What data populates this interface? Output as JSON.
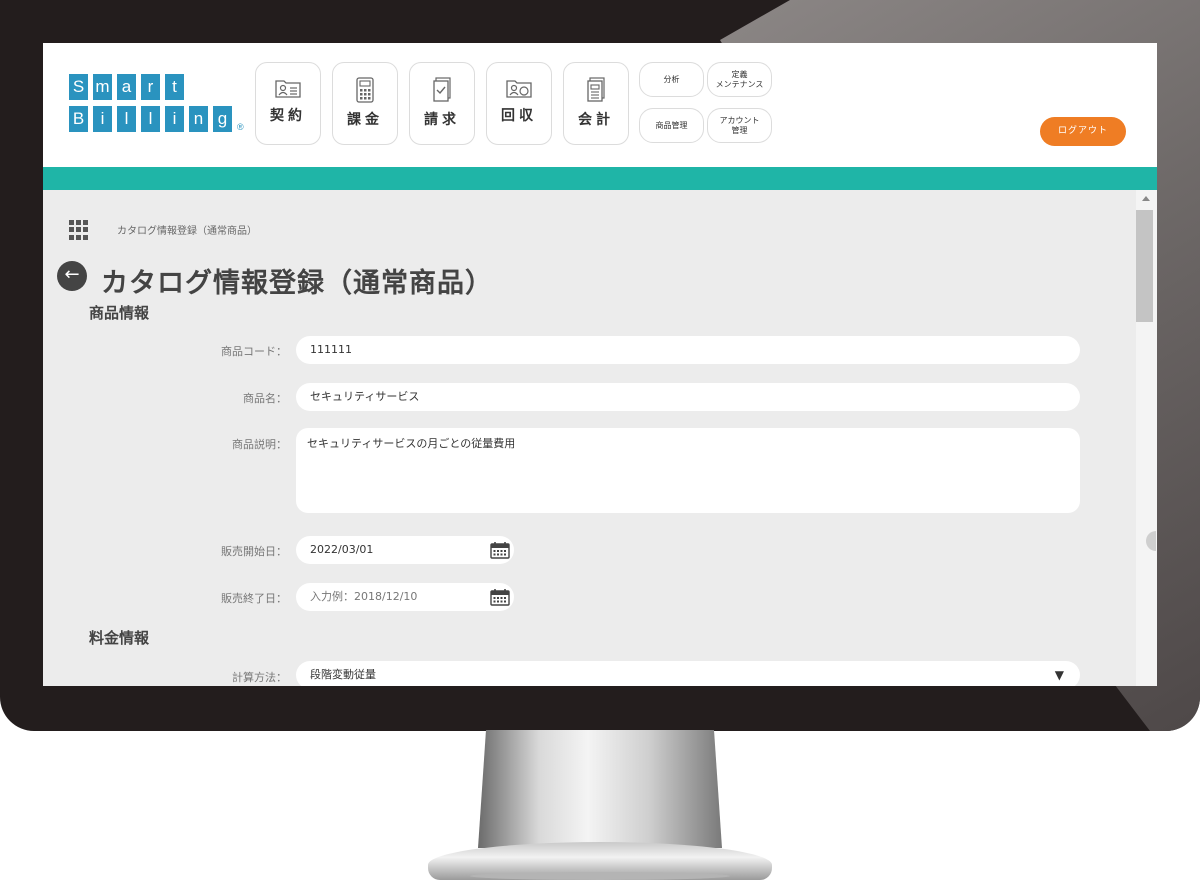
{
  "logo": {
    "row1": [
      "S",
      "m",
      "a",
      "r",
      "t"
    ],
    "row2": [
      "B",
      "i",
      "l",
      "l",
      "i",
      "n",
      "g"
    ],
    "reg": "®"
  },
  "nav": {
    "main": [
      {
        "label": "契約",
        "icon": "contract-icon"
      },
      {
        "label": "課金",
        "icon": "calculator-icon"
      },
      {
        "label": "請求",
        "icon": "invoice-icon"
      },
      {
        "label": "回収",
        "icon": "collection-icon"
      },
      {
        "label": "会計",
        "icon": "accounting-icon"
      }
    ],
    "sub": {
      "analysis": "分析",
      "definition_maintenance": "定義\nメンテナンス",
      "product_management": "商品管理",
      "account_management": "アカウント\n管理"
    },
    "logout": "ログアウト"
  },
  "breadcrumb": "カタログ情報登録（通常商品）",
  "page_title": "カタログ情報登録（通常商品）",
  "sections": {
    "product_info": "商品情報",
    "price_info": "料金情報"
  },
  "form": {
    "product_code": {
      "label": "商品コード：",
      "value": "111111"
    },
    "product_name": {
      "label": "商品名：",
      "value": "セキュリティサービス"
    },
    "product_description": {
      "label": "商品説明：",
      "value": "セキュリティサービスの月ごとの従量費用"
    },
    "sale_start_date": {
      "label": "販売開始日：",
      "value": "2022/03/01"
    },
    "sale_end_date": {
      "label": "販売終了日：",
      "placeholder": "入力例：2018/12/10"
    },
    "calc_method": {
      "label": "計算方法：",
      "value": "段階変動従量"
    }
  },
  "colors": {
    "accent_teal": "#1fb5a7",
    "logo_blue": "#2a93bf",
    "logout_orange": "#ef7d24"
  }
}
